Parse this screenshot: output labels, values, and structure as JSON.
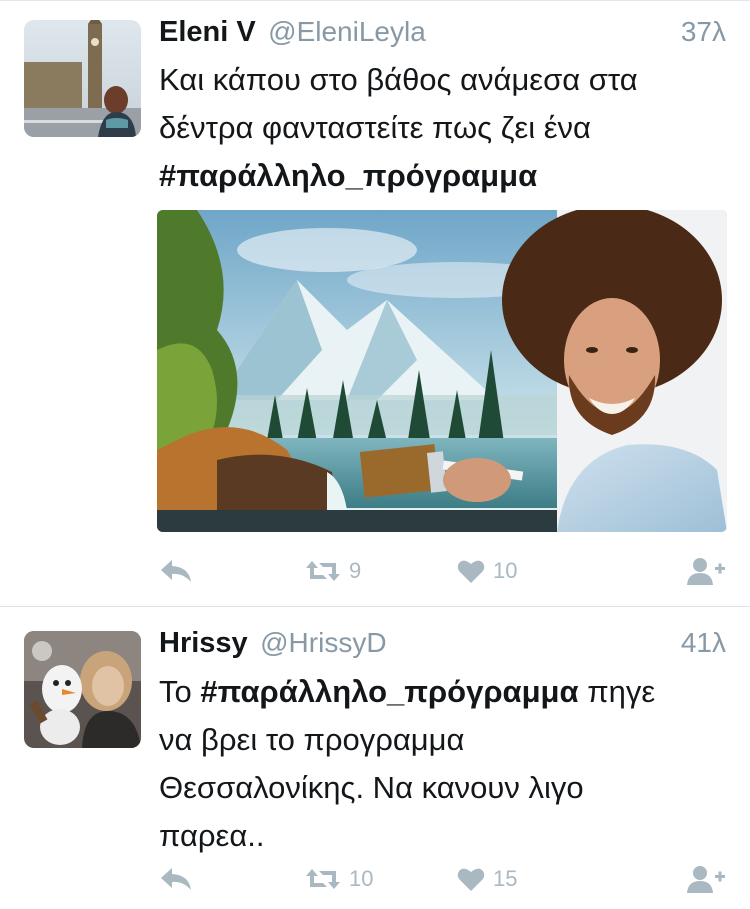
{
  "tweets": [
    {
      "name": "Eleni V",
      "handle": "@EleniLeyla",
      "time": "37λ",
      "text_lines": [
        "Και κάπου στο βάθος ανάμεσα στα",
        "δέντρα φανταστείτε πως ζει ένα"
      ],
      "hashtag": "#παράλληλο_πρόγραμμα",
      "retweets": "9",
      "likes": "10"
    },
    {
      "name": "Hrissy",
      "handle": "@HrissyD",
      "time": "41λ",
      "text_prefix": "Το ",
      "hashtag": "#παράλληλο_πρόγραμμα",
      "text_after_hashtag": " πηγε",
      "text_lines": [
        "να βρει το προγραμμα",
        "Θεσσαλονίκης. Να κανουν λιγο",
        "παρεα.."
      ],
      "retweets": "10",
      "likes": "15"
    }
  ],
  "colors": {
    "text": "#14171a",
    "secondary": "#8899a6",
    "icon": "#aab8c2",
    "divider": "#dfe3e6"
  },
  "icons": [
    "reply-icon",
    "retweet-icon",
    "heart-icon",
    "follow-icon"
  ]
}
